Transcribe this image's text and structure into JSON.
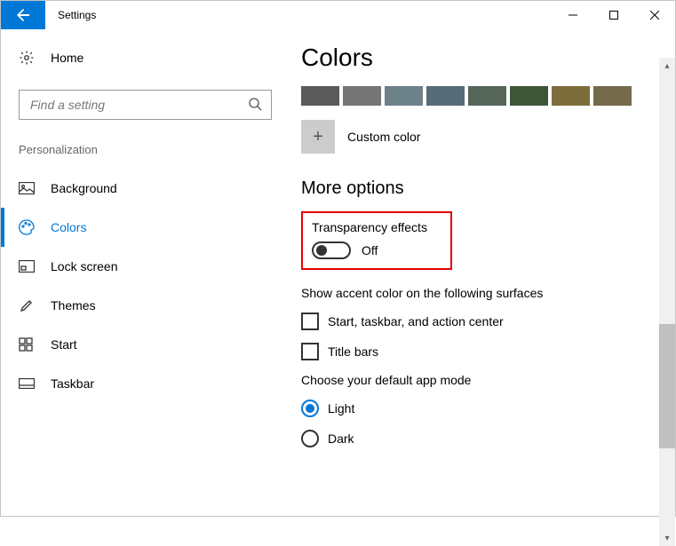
{
  "titlebar": {
    "title": "Settings"
  },
  "sidebar": {
    "home": "Home",
    "search_placeholder": "Find a setting",
    "category": "Personalization",
    "items": [
      {
        "label": "Background"
      },
      {
        "label": "Colors"
      },
      {
        "label": "Lock screen"
      },
      {
        "label": "Themes"
      },
      {
        "label": "Start"
      },
      {
        "label": "Taskbar"
      }
    ]
  },
  "main": {
    "title": "Colors",
    "swatches": [
      "#5a5a5a",
      "#757575",
      "#6d8189",
      "#576a77",
      "#56675a",
      "#3e5638",
      "#7e6d3c",
      "#746a4c"
    ],
    "custom_label": "Custom color",
    "more_options": "More options",
    "transparency_label": "Transparency effects",
    "transparency_state": "Off",
    "accent_surfaces_label": "Show accent color on the following surfaces",
    "checkbox1": "Start, taskbar, and action center",
    "checkbox2": "Title bars",
    "app_mode_label": "Choose your default app mode",
    "radio_light": "Light",
    "radio_dark": "Dark"
  }
}
